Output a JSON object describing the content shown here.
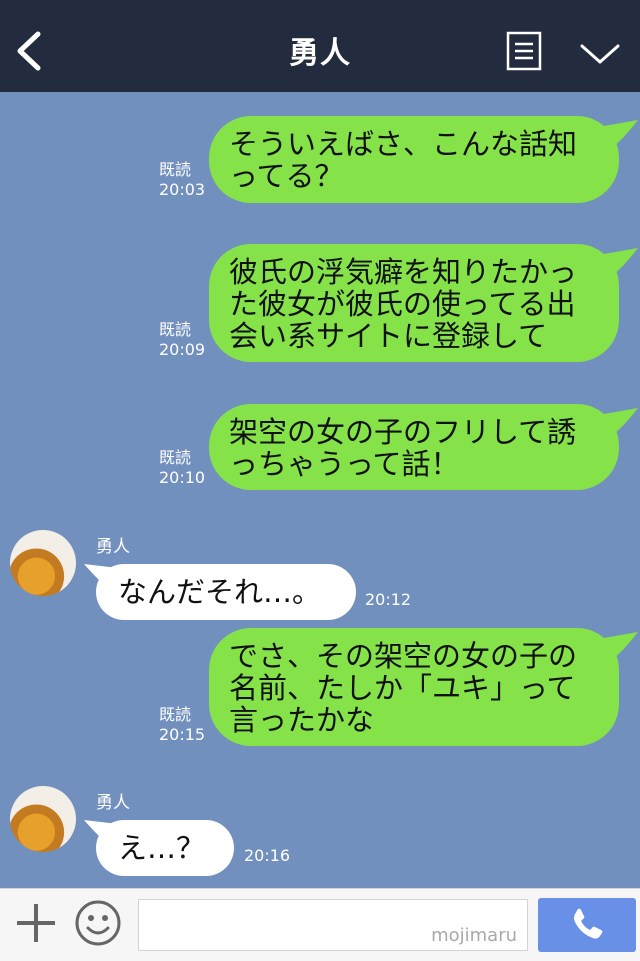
{
  "header": {
    "title": "勇人",
    "back_icon": "chevron-left-icon",
    "menu_icon": "list-menu-icon",
    "expand_icon": "chevron-down-icon"
  },
  "messages": [
    {
      "direction": "out",
      "read_label": "既読",
      "time": "20:03",
      "lines": [
        "そういえばさ、こんな話知",
        "ってる？"
      ]
    },
    {
      "direction": "out",
      "read_label": "既読",
      "time": "20:09",
      "lines": [
        "彼氏の浮気癖を知りたかっ",
        "た彼女が彼氏の使ってる出",
        "会い系サイトに登録して"
      ]
    },
    {
      "direction": "out",
      "read_label": "既読",
      "time": "20:10",
      "lines": [
        "架空の女の子のフリして誘",
        "っちゃうって話！"
      ]
    },
    {
      "direction": "in",
      "sender": "勇人",
      "time": "20:12",
      "lines": [
        "なんだそれ…。"
      ]
    },
    {
      "direction": "out",
      "read_label": "既読",
      "time": "20:15",
      "lines": [
        "でさ、その架空の女の子の",
        "名前、たしか「ユキ」って",
        "言ったかな"
      ]
    },
    {
      "direction": "in",
      "sender": "勇人",
      "time": "20:16",
      "lines": [
        "え…？"
      ]
    }
  ],
  "footer": {
    "plus_icon": "plus-icon",
    "emoji_icon": "smiley-icon",
    "input_value": "",
    "watermark": "mojimaru",
    "call_icon": "phone-icon"
  },
  "colors": {
    "background": "#7290be",
    "header": "#232b3f",
    "outgoing_bubble": "#85e249",
    "incoming_bubble": "#ffffff",
    "call_button": "#6790e6"
  }
}
